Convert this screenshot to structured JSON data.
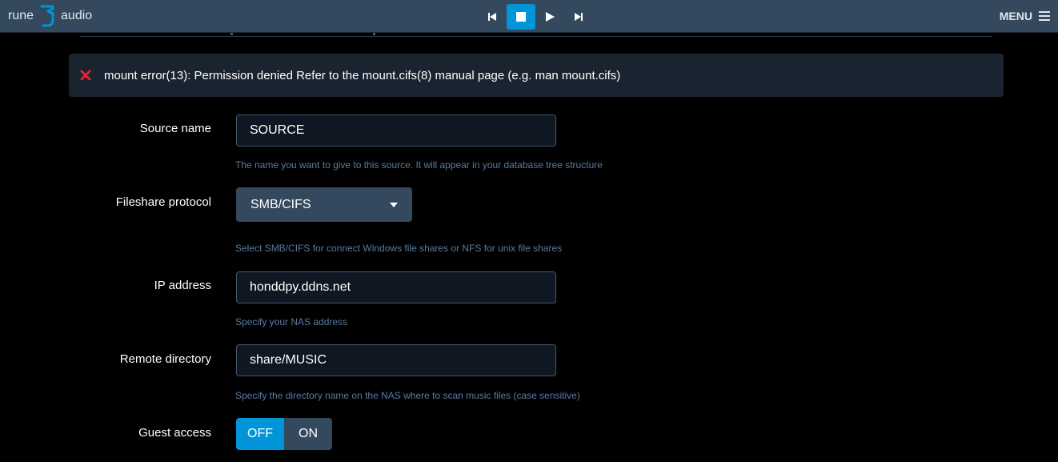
{
  "header": {
    "logo_left": "rune",
    "logo_right": "audio",
    "menu_label": "MENU",
    "controls": [
      "previous-icon",
      "stop-icon",
      "play-icon",
      "next-icon"
    ],
    "active_control": "stop"
  },
  "alert": {
    "icon": "error-x-icon",
    "message": "mount error(13): Permission denied Refer to the mount.cifs(8) manual page (e.g. man mount.cifs)"
  },
  "form": {
    "source_name": {
      "label": "Source name",
      "value": "SOURCE",
      "help": "The name you want to give to this source. It will appear in your database tree structure"
    },
    "protocol": {
      "label": "Fileshare protocol",
      "value": "SMB/CIFS",
      "help": "Select SMB/CIFS for connect Windows file shares or NFS for unix file shares"
    },
    "ip_address": {
      "label": "IP address",
      "value": "honddpy.ddns.net",
      "help": "Specify your NAS address"
    },
    "remote_directory": {
      "label": "Remote directory",
      "value": "share/MUSIC",
      "help": "Specify the directory name on the NAS where to scan music files (case sensitive)"
    },
    "guest_access": {
      "label": "Guest access",
      "off_label": "OFF",
      "on_label": "ON",
      "selected": "OFF"
    }
  },
  "colors": {
    "accent": "#0095d8",
    "header_bg": "#34495e",
    "error": "#e0262d",
    "help_text": "#587ca0"
  }
}
